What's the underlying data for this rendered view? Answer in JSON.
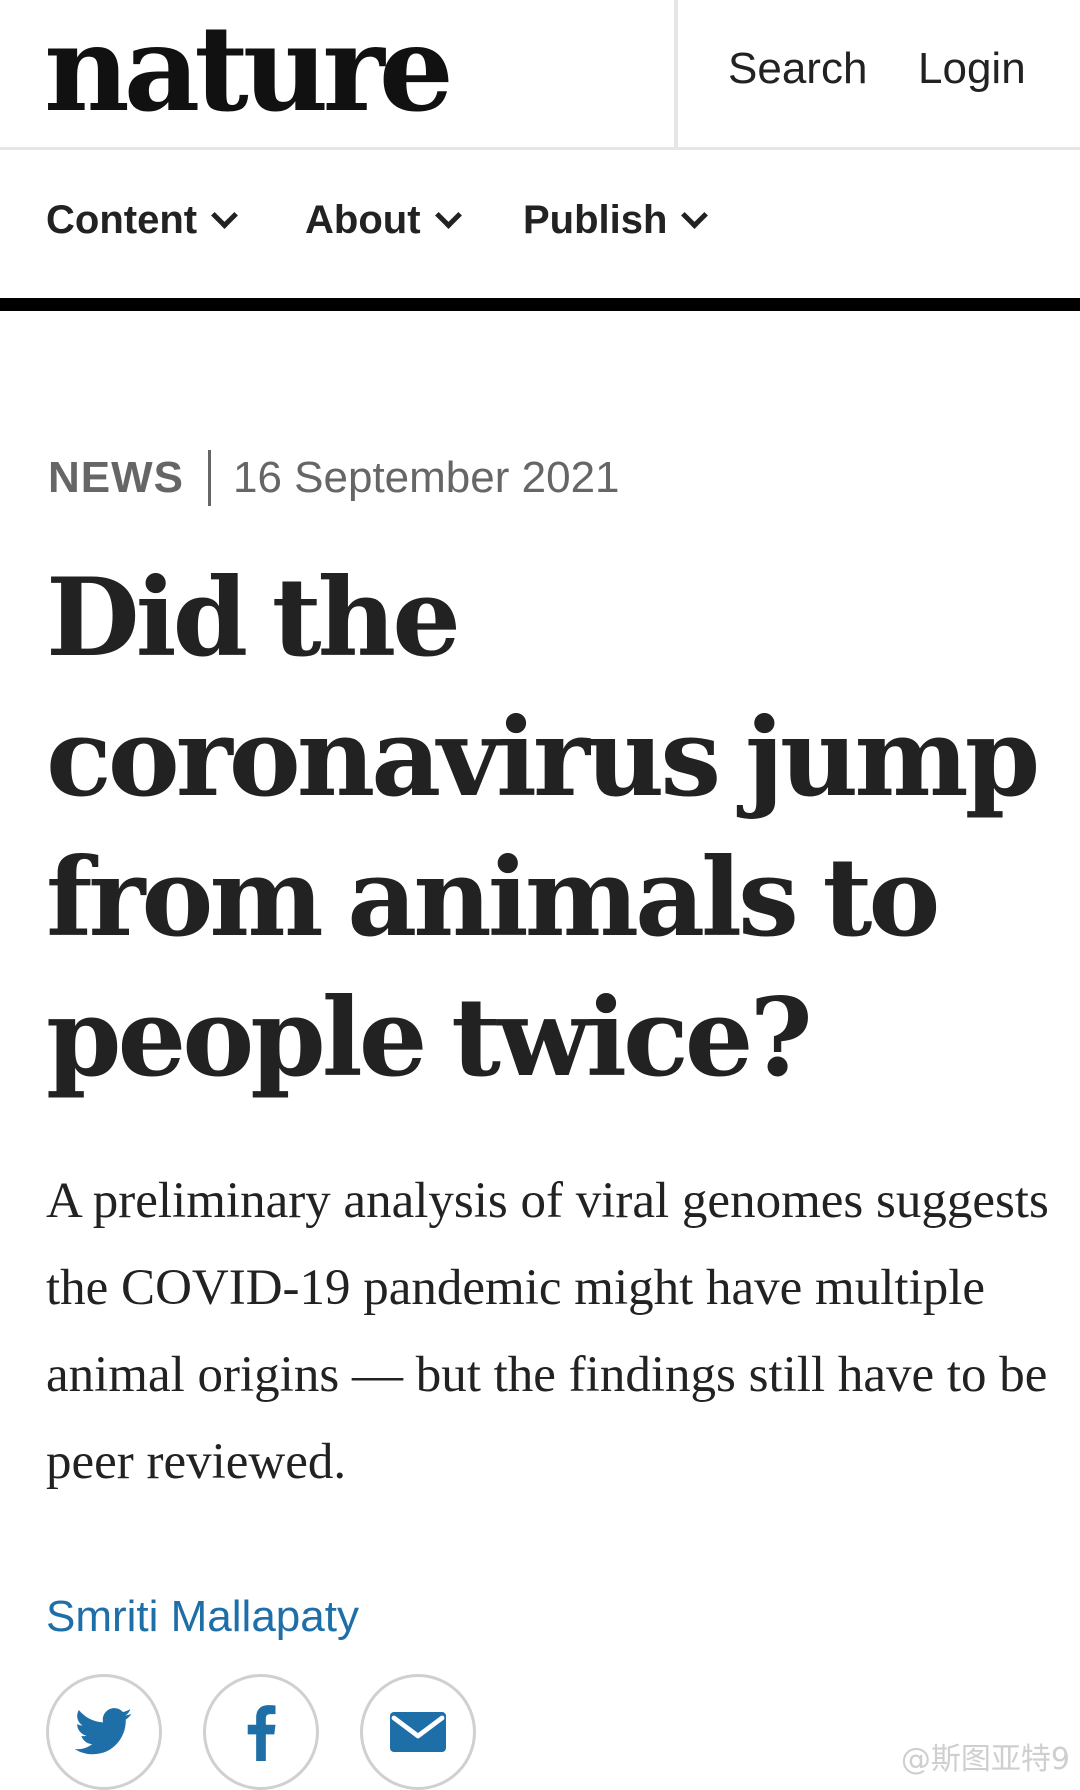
{
  "header": {
    "logo": "nature",
    "search_label": "Search",
    "login_label": "Login"
  },
  "nav": {
    "items": [
      {
        "label": "Content"
      },
      {
        "label": "About"
      },
      {
        "label": "Publish"
      }
    ]
  },
  "article": {
    "type": "NEWS",
    "date": "16 September 2021",
    "title": "Did the coronavirus jump from animals to people twice?",
    "standfirst": "A preliminary analysis of viral genomes suggests the COVID-19 pandemic might have multiple animal origins — but the findings still have to be peer reviewed.",
    "author": "Smriti Mallapaty"
  },
  "share": {
    "buttons": [
      "twitter-icon",
      "facebook-icon",
      "email-icon"
    ],
    "colors": {
      "twitter": "#1e6fa8",
      "facebook": "#1e6fa8",
      "email": "#1e6fa8"
    }
  },
  "watermark": "@斯图亚特9"
}
